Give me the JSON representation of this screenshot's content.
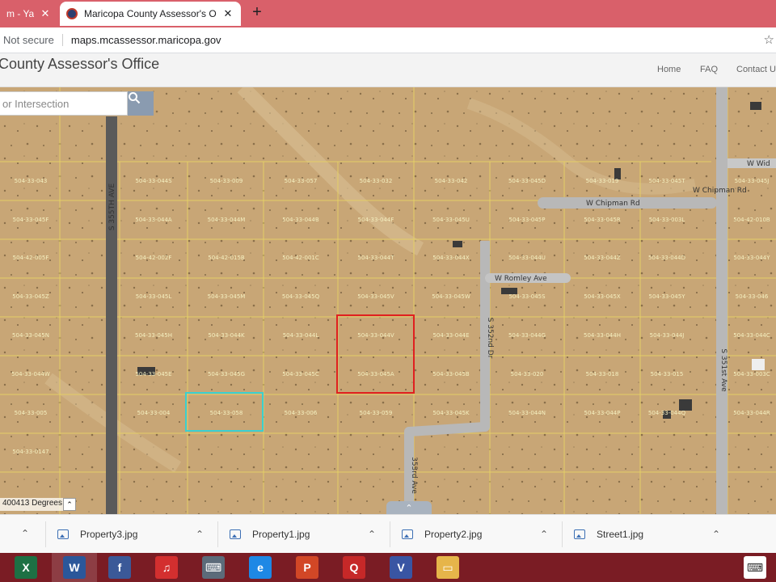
{
  "browser": {
    "tabs": [
      {
        "title": "m - Yaho",
        "active": false
      },
      {
        "title": "Maricopa County Assessor's Offic",
        "active": true
      }
    ],
    "new_tab_label": "+",
    "close_label": "✕",
    "security_label": "Not secure",
    "url": "maps.mcassessor.maricopa.gov",
    "bookmark_icon": "☆"
  },
  "site": {
    "title": "County Assessor's Office",
    "nav": {
      "home": "Home",
      "faq": "FAQ",
      "contact": "Contact U"
    }
  },
  "map": {
    "search_placeholder": "or Intersection",
    "coordinate_readout": "400413 Degrees",
    "coord_button": "⌃",
    "collapse_button": "⌃",
    "streets": {
      "s355th_ave": "S 355TH AVE",
      "w_chipman_rd": "W Chipman Rd",
      "w_chipman_rd_2": "W Chipman Rd",
      "w_romley_ave": "W Romley Ave",
      "s352nd_dr": "S 352nd Dr",
      "s351st_ave": "S 351st Ave",
      "s353rd_ave": "353rd Ave",
      "w_wid": "W Wid"
    },
    "parcels": [
      "504-33-043",
      "504-33-044S",
      "504-33-009",
      "504-33-057",
      "504-33-032",
      "504-33-042",
      "504-33-045D",
      "504-33-019",
      "504-33-045T",
      "504-33-045J",
      "504-33-045F",
      "504-33-044A",
      "504-33-044M",
      "504-33-044B",
      "504-33-044F",
      "504-33-045U",
      "504-33-045P",
      "504-33-045R",
      "504-33-003L",
      "504-42-010B",
      "504-42-005F",
      "504-42-002F",
      "504-42-015B",
      "504-42-001C",
      "504-33-044T",
      "504-33-044X",
      "504-33-044U",
      "504-33-044Z",
      "504-33-044D",
      "504-33-044Y",
      "504-33-045Z",
      "504-33-045L",
      "504-33-045M",
      "504-33-045Q",
      "504-33-045V",
      "504-33-045W",
      "504-33-045S",
      "504-33-045X",
      "504-33-045Y",
      "504-33-046",
      "504-33-045N",
      "504-33-045H",
      "504-33-044K",
      "504-33-044L",
      "504-33-044V",
      "504-33-044E",
      "504-33-044G",
      "504-33-044H",
      "504-33-044J",
      "504-33-044C",
      "504-33-044W",
      "504-33-045E",
      "504-33-045G",
      "504-33-045C",
      "504-33-045A",
      "504-33-045B",
      "504-33-020",
      "504-33-018",
      "504-33-015",
      "504-33-003C",
      "504-33-005",
      "504-33-004",
      "504-33-058",
      "504-33-006",
      "504-33-059",
      "504-33-045K",
      "504-33-044N",
      "504-33-044P",
      "504-33-044Q",
      "504-33-044R",
      "504-33-0147"
    ]
  },
  "downloads": {
    "items": [
      "Property3.jpg",
      "Property1.jpg",
      "Property2.jpg",
      "Street1.jpg"
    ],
    "chevron": "⌃"
  },
  "taskbar": {
    "icons": [
      {
        "name": "excel",
        "label": "X",
        "color": "#1d7044"
      },
      {
        "name": "word",
        "label": "W",
        "color": "#2b579a"
      },
      {
        "name": "facebook",
        "label": "f",
        "color": "#3b5998"
      },
      {
        "name": "music",
        "label": "♫",
        "color": "#d32f2f"
      },
      {
        "name": "network",
        "label": "⌨",
        "color": "#5c6b7a"
      },
      {
        "name": "internet-explorer",
        "label": "e",
        "color": "#1e88e5"
      },
      {
        "name": "powerpoint",
        "label": "P",
        "color": "#d24726"
      },
      {
        "name": "quicken",
        "label": "Q",
        "color": "#c62828"
      },
      {
        "name": "visio",
        "label": "V",
        "color": "#3955a3"
      },
      {
        "name": "file-explorer",
        "label": "▭",
        "color": "#e6b54a"
      },
      {
        "name": "keyboard",
        "label": "⌨",
        "color": "#ffffff"
      }
    ]
  },
  "colors": {
    "tab_bar": "#d9606a",
    "selected_parcel_red": "#e02020",
    "selected_parcel_cyan": "#3ad0d0",
    "parcel_lines": "#e8d36a",
    "taskbar": "#7a1c24"
  }
}
